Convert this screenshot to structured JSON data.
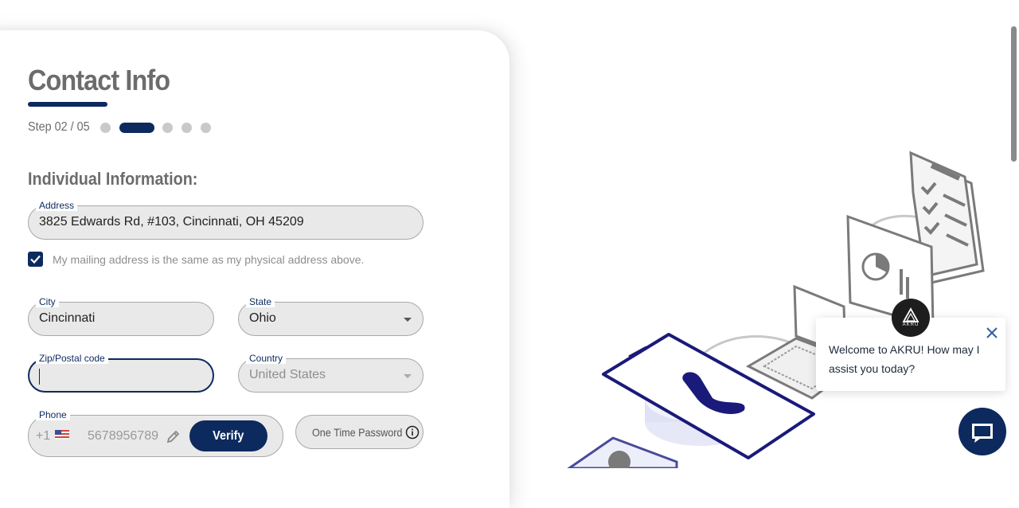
{
  "form": {
    "title": "Contact Info",
    "step_text": "Step 02 / 05",
    "step_current": 2,
    "step_total": 5,
    "section_title": "Individual Information:",
    "address": {
      "label": "Address",
      "value": "3825 Edwards Rd, #103, Cincinnati, OH 45209"
    },
    "mailing_same": {
      "label": "My mailing address is the same as my physical address above.",
      "checked": true
    },
    "city": {
      "label": "City",
      "value": "Cincinnati"
    },
    "state": {
      "label": "State",
      "value": "Ohio"
    },
    "zip": {
      "label": "Zip/Postal code",
      "value": ""
    },
    "country": {
      "label": "Country",
      "value": "United States"
    },
    "phone": {
      "label": "Phone",
      "code": "+1",
      "flag": "us-flag-icon",
      "number": "5678956789",
      "verify_label": "Verify"
    },
    "otp": {
      "placeholder": "One Time Password"
    }
  },
  "chat": {
    "brand": "AKRU",
    "message": "Welcome to AKRU! How may I assist you today?"
  },
  "colors": {
    "accent": "#0c2a5e",
    "field_bg": "#e9e9e9",
    "muted_text": "#8e8e8e",
    "heading_text": "#6c6c6c"
  }
}
